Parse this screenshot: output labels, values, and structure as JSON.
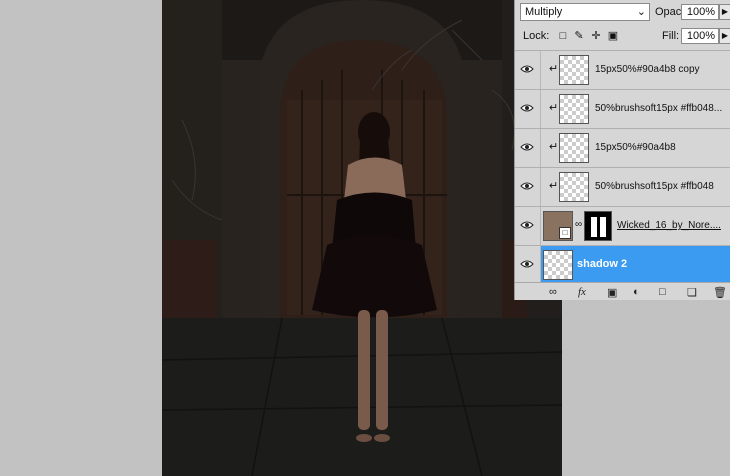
{
  "blend_mode": "Multiply",
  "opacity": {
    "label": "Opacity:",
    "value": "100%"
  },
  "lock": {
    "label": "Lock:"
  },
  "fill": {
    "label": "Fill:",
    "value": "100%"
  },
  "layers": [
    {
      "name": "15px50%#90a4b8 copy",
      "clipped": true,
      "visible": true,
      "selected": false
    },
    {
      "name": "50%brushsoft15px #ffb048...",
      "clipped": true,
      "visible": true,
      "selected": false
    },
    {
      "name": "15px50%#90a4b8",
      "clipped": true,
      "visible": true,
      "selected": false
    },
    {
      "name": "50%brushsoft15px #ffb048",
      "clipped": true,
      "visible": true,
      "selected": false
    },
    {
      "name": "Wicked_16_by_Nore....",
      "clipped": false,
      "visible": true,
      "selected": false,
      "smart_object": true,
      "has_mask": true
    },
    {
      "name": "shadow 2",
      "clipped": false,
      "visible": true,
      "selected": true
    }
  ],
  "footer_icons": [
    "link-icon",
    "fx-icon",
    "mask-icon",
    "adjustment-icon",
    "group-folder-icon",
    "new-layer-icon",
    "trash-icon"
  ],
  "footer_fx_label": "fx",
  "colors": {
    "selection": "#3a9bf0",
    "panel": "#d6d6d6",
    "workspace": "#c2c2c2"
  }
}
